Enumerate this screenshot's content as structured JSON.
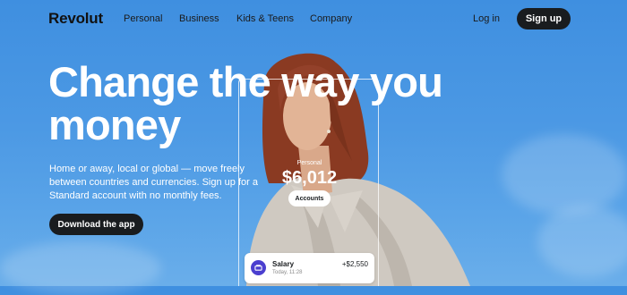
{
  "nav": {
    "logo": "Revolut",
    "links": [
      "Personal",
      "Business",
      "Kids & Teens",
      "Company"
    ],
    "login": "Log in",
    "signup": "Sign up"
  },
  "hero": {
    "title_line1": "Change the way you",
    "title_line2": "money",
    "subtitle": "Home or away, local or global — move freely between countries and currencies. Sign up for a Standard account with no monthly fees.",
    "cta": "Download the app"
  },
  "balance": {
    "label": "Personal",
    "amount": "$6,012",
    "accounts_button": "Accounts"
  },
  "transaction": {
    "name": "Salary",
    "time": "Today, 11:28",
    "amount": "+$2,550"
  },
  "colors": {
    "sky": "#4c99e4",
    "button_dark": "#191c1f",
    "accent_purple": "#4b3fcf"
  }
}
